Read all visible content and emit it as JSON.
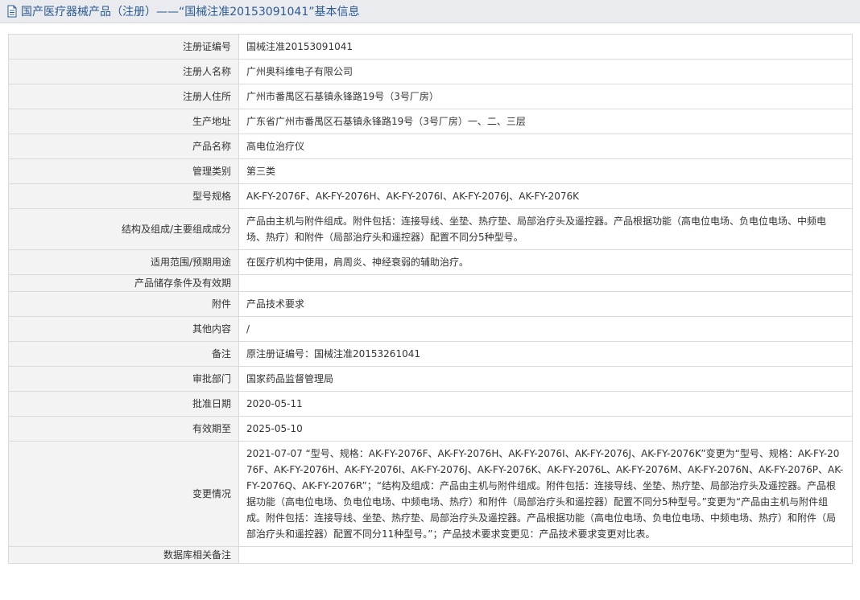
{
  "header": {
    "title": "国产医疗器械产品（注册）——“国械注准20153091041”基本信息"
  },
  "rows": [
    {
      "label": "注册证编号",
      "value": "国械注准20153091041"
    },
    {
      "label": "注册人名称",
      "value": "广州奥科维电子有限公司"
    },
    {
      "label": "注册人住所",
      "value": "广州市番禺区石基镇永锋路19号（3号厂房）"
    },
    {
      "label": "生产地址",
      "value": "广东省广州市番禺区石基镇永锋路19号（3号厂房）一、二、三层"
    },
    {
      "label": "产品名称",
      "value": "高电位治疗仪"
    },
    {
      "label": "管理类别",
      "value": "第三类"
    },
    {
      "label": "型号规格",
      "value": "AK-FY-2076F、AK-FY-2076H、AK-FY-2076I、AK-FY-2076J、AK-FY-2076K"
    },
    {
      "label": "结构及组成/主要组成成分",
      "value": "产品由主机与附件组成。附件包括：连接导线、坐垫、热疗垫、局部治疗头及遥控器。产品根据功能（高电位电场、负电位电场、中频电场、热疗）和附件（局部治疗头和遥控器）配置不同分5种型号。"
    },
    {
      "label": "适用范围/预期用途",
      "value": "在医疗机构中使用，肩周炎、神经衰弱的辅助治疗。"
    },
    {
      "label": "产品储存条件及有效期",
      "value": ""
    },
    {
      "label": "附件",
      "value": "产品技术要求"
    },
    {
      "label": "其他内容",
      "value": "/"
    },
    {
      "label": "备注",
      "value": "原注册证编号：国械注准20153261041"
    },
    {
      "label": "审批部门",
      "value": "国家药品监督管理局"
    },
    {
      "label": "批准日期",
      "value": "2020-05-11"
    },
    {
      "label": "有效期至",
      "value": "2025-05-10"
    },
    {
      "label": "变更情况",
      "value": "2021-07-07 “型号、规格：AK-FY-2076F、AK-FY-2076H、AK-FY-2076I、AK-FY-2076J、AK-FY-2076K”变更为“型号、规格：AK-FY-2076F、AK-FY-2076H、AK-FY-2076I、AK-FY-2076J、AK-FY-2076K、AK-FY-2076L、AK-FY-2076M、AK-FY-2076N、AK-FY-2076P、AK-FY-2076Q、AK-FY-2076R”；“结构及组成：产品由主机与附件组成。附件包括：连接导线、坐垫、热疗垫、局部治疗头及遥控器。产品根据功能（高电位电场、负电位电场、中频电场、热疗）和附件（局部治疗头和遥控器）配置不同分5种型号。”变更为“产品由主机与附件组成。附件包括：连接导线、坐垫、热疗垫、局部治疗头及遥控器。产品根据功能（高电位电场、负电位电场、中频电场、热疗）和附件（局部治疗头和遥控器）配置不同分11种型号。”；产品技术要求变更见：产品技术要求变更对比表。"
    },
    {
      "label": "数据库相关备注",
      "value": ""
    }
  ]
}
